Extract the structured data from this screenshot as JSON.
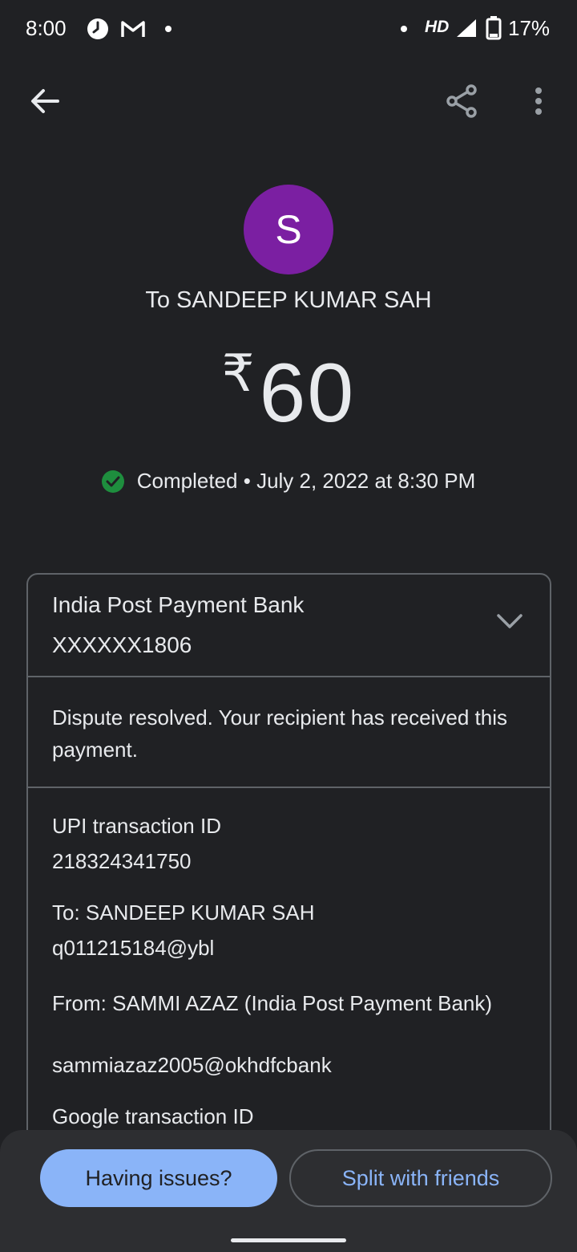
{
  "status_bar": {
    "time": "8:00",
    "icons": [
      "clock-icon",
      "gmail-icon",
      "notification-dot",
      "signal-dot",
      "hd-icon",
      "cell-signal-icon",
      "battery-icon"
    ],
    "network": "HD",
    "battery": "17%"
  },
  "app_bar": {
    "back_icon": "arrow-back-icon",
    "share_icon": "share-icon",
    "more_icon": "more-vert-icon"
  },
  "header": {
    "avatar_letter": "S",
    "avatar_color": "#7b1fa2",
    "recipient_title": "To SANDEEP KUMAR SAH",
    "currency_symbol": "₹",
    "amount": "60",
    "status": "Completed",
    "separator": " • ",
    "datetime": "July 2, 2022 at 8:30 PM",
    "status_color": "#1e8e3e"
  },
  "card": {
    "bank_name": "India Post Payment Bank",
    "account": "XXXXXX1806",
    "dispute_message": "Dispute resolved. Your recipient has received this payment.",
    "details": {
      "upi_label": "UPI transaction ID",
      "upi_value": "218324341750",
      "to_label": "To: SANDEEP KUMAR SAH",
      "to_value": "q011215184@ybl",
      "from_label": "From: SAMMI AZAZ (India Post Payment Bank)",
      "from_value": "sammiazaz2005@okhdfcbank",
      "google_label": "Google transaction ID"
    }
  },
  "actions": {
    "issues_label": "Having issues?",
    "split_label": "Split with friends",
    "accent": "#8ab4f8"
  }
}
